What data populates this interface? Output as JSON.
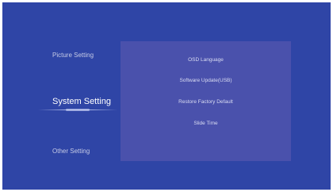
{
  "sidebar": {
    "items": [
      {
        "label": "Picture Setting"
      },
      {
        "label": "System Setting"
      },
      {
        "label": "Other Setting"
      }
    ],
    "selected": "System Setting"
  },
  "panel": {
    "items": [
      {
        "label": "OSD Language"
      },
      {
        "label": "Software Update(USB)"
      },
      {
        "label": "Restore Factory Default"
      },
      {
        "label": "Slide Time"
      }
    ]
  },
  "colors": {
    "background": "#2f45a6",
    "panel": "#4a51ac",
    "selected_text": "#ffffff",
    "text": "#c6cbe6"
  }
}
